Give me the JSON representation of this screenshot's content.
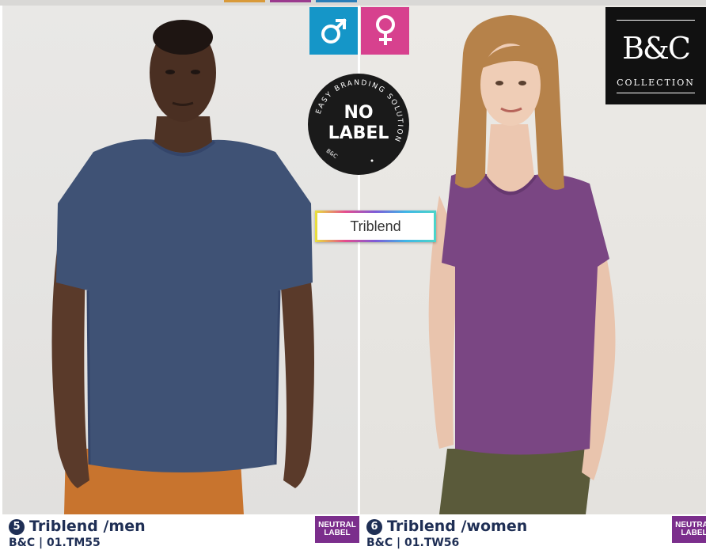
{
  "brand": {
    "logo_mark": "B&C",
    "logo_text": "COLLECTION"
  },
  "gender_icons": {
    "male": "male-symbol-icon",
    "female": "female-symbol-icon",
    "male_color": "#1596c8",
    "female_color": "#d7418e"
  },
  "no_label_badge": {
    "curved_text": "EASY BRANDING SOLUTION",
    "line1": "NO",
    "line2": "LABEL",
    "small": "B&C"
  },
  "fabric_badge": {
    "label": "Triblend"
  },
  "products": [
    {
      "number": "5",
      "title": "Triblend /men",
      "code": "B&C | 01.TM55",
      "tag_line1": "NEUTRAL",
      "tag_line2": "LABEL",
      "shirt_color": "#3f5275"
    },
    {
      "number": "6",
      "title": "Triblend /women",
      "code": "B&C | 01.TW56",
      "tag_line1": "NEUTRAL",
      "tag_line2": "LABEL",
      "shirt_color": "#7a4683"
    }
  ]
}
